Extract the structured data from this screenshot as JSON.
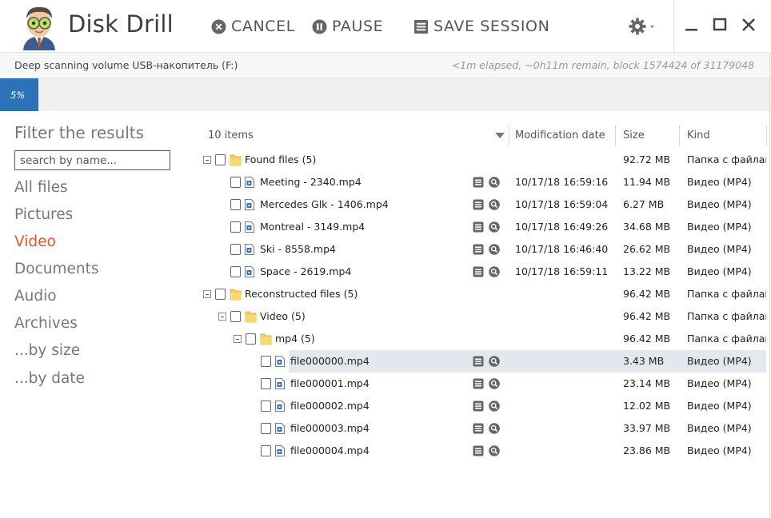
{
  "app": {
    "title": "Disk Drill"
  },
  "toolbar": {
    "cancel_label": "CANCEL",
    "pause_label": "PAUSE",
    "save_label": "SAVE SESSION"
  },
  "status": {
    "left": "Deep scanning volume USB-накопитель (F:)",
    "right": "<1m elapsed, ~0h11m remain, block 1574424 of 31179048"
  },
  "progress": {
    "label": "5%",
    "fraction": 0.05
  },
  "sidebar": {
    "title": "Filter the results",
    "search_placeholder": "search by name...",
    "items": [
      {
        "label": "All files"
      },
      {
        "label": "Pictures"
      },
      {
        "label": "Video",
        "active": true
      },
      {
        "label": "Documents"
      },
      {
        "label": "Audio"
      },
      {
        "label": "Archives"
      },
      {
        "label": "...by size"
      },
      {
        "label": "...by date"
      }
    ]
  },
  "table": {
    "count": "10 items",
    "columns": {
      "date": "Modification date",
      "size": "Size",
      "kind": "Kind"
    },
    "rows": [
      {
        "type": "folder",
        "level": 0,
        "name": "Found files (5)",
        "date": "",
        "size": "92.72 MB",
        "kind": "Папка с файлами"
      },
      {
        "type": "file",
        "level": 1,
        "name": "Meeting - 2340.mp4",
        "date": "10/17/18 16:59:16",
        "size": "11.94 MB",
        "kind": "Видео (MP4)"
      },
      {
        "type": "file",
        "level": 1,
        "name": "Mercedes Glk - 1406.mp4",
        "date": "10/17/18 16:59:04",
        "size": "6.27 MB",
        "kind": "Видео (MP4)"
      },
      {
        "type": "file",
        "level": 1,
        "name": "Montreal - 3149.mp4",
        "date": "10/17/18 16:49:26",
        "size": "34.68 MB",
        "kind": "Видео (MP4)"
      },
      {
        "type": "file",
        "level": 1,
        "name": "Ski - 8558.mp4",
        "date": "10/17/18 16:46:40",
        "size": "26.62 MB",
        "kind": "Видео (MP4)"
      },
      {
        "type": "file",
        "level": 1,
        "name": "Space - 2619.mp4",
        "date": "10/17/18 16:59:11",
        "size": "13.22 MB",
        "kind": "Видео (MP4)"
      },
      {
        "type": "folder",
        "level": 0,
        "name": "Reconstructed files (5)",
        "date": "",
        "size": "96.42 MB",
        "kind": "Папка с файлами"
      },
      {
        "type": "folder",
        "level": 1,
        "name": "Video (5)",
        "date": "",
        "size": "96.42 MB",
        "kind": "Папка с файлами"
      },
      {
        "type": "folder",
        "level": 2,
        "name": "mp4 (5)",
        "date": "",
        "size": "96.42 MB",
        "kind": "Папка с файлами"
      },
      {
        "type": "file",
        "level": 3,
        "name": "file000000.mp4",
        "date": "",
        "size": "3.43 MB",
        "kind": "Видео (MP4)",
        "selected": true
      },
      {
        "type": "file",
        "level": 3,
        "name": "file000001.mp4",
        "date": "",
        "size": "23.14 MB",
        "kind": "Видео (MP4)"
      },
      {
        "type": "file",
        "level": 3,
        "name": "file000002.mp4",
        "date": "",
        "size": "12.02 MB",
        "kind": "Видео (MP4)"
      },
      {
        "type": "file",
        "level": 3,
        "name": "file000003.mp4",
        "date": "",
        "size": "33.97 MB",
        "kind": "Видео (MP4)"
      },
      {
        "type": "file",
        "level": 3,
        "name": "file000004.mp4",
        "date": "",
        "size": "23.86 MB",
        "kind": "Видео (MP4)"
      }
    ]
  },
  "icons": {
    "avatar": "mascot-avatar",
    "cancel": "close-circle-icon",
    "pause": "pause-circle-icon",
    "save": "list-document-icon",
    "settings": "gear-icon",
    "minimize": "minimize-icon",
    "maximize": "maximize-icon",
    "close": "close-icon",
    "sort": "sort-arrow-icon",
    "folder": "folder-icon",
    "file": "video-file-icon",
    "details": "details-icon",
    "preview": "preview-icon"
  },
  "colors": {
    "accent": "#e8542a",
    "progress": "#2b72b8",
    "selected_row": "#e3e8ee"
  }
}
